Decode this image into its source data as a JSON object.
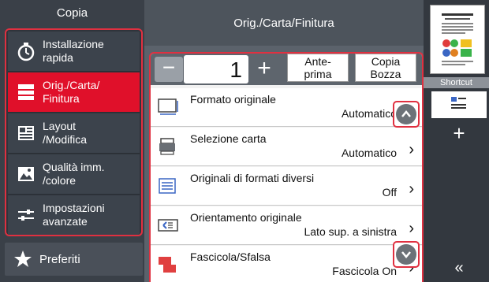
{
  "left_panel": {
    "title": "Copia",
    "items": [
      {
        "label": "Installazione\nrapida",
        "icon": "stopwatch-icon"
      },
      {
        "label": "Orig./Carta/\nFinitura",
        "icon": "document-stack-icon",
        "active": true
      },
      {
        "label": "Layout\n/Modifica",
        "icon": "layout-icon"
      },
      {
        "label": "Qualità imm.\n/colore",
        "icon": "image-quality-icon"
      },
      {
        "label": "Impostazioni\navanzate",
        "icon": "sliders-icon"
      }
    ],
    "favorites_label": "Preferiti"
  },
  "center_panel": {
    "title": "Orig./Carta/Finitura",
    "copies": {
      "minus": "−",
      "value": "1",
      "plus": "+"
    },
    "preview_label": "Ante-\nprima",
    "draft_label": "Copia\nBozza",
    "rows": [
      {
        "label": "Formato originale",
        "value": "Automatico",
        "icon": "original-size-icon"
      },
      {
        "label": "Selezione carta",
        "value": "Automatico",
        "icon": "paper-tray-icon"
      },
      {
        "label": "Originali di formati diversi",
        "value": "Off",
        "icon": "mixed-originals-icon"
      },
      {
        "label": "Orientamento originale",
        "value": "Lato sup. a sinistra",
        "icon": "orientation-icon"
      },
      {
        "label": "Fascicola/Sfalsa",
        "value": "Fascicola On",
        "icon": "collate-icon"
      }
    ]
  },
  "right_panel": {
    "shortcut_label": "Shortcut",
    "add_label": "+",
    "collapse_label": "«"
  },
  "colors": {
    "accent": "#e0102a",
    "outline": "#e03040"
  }
}
